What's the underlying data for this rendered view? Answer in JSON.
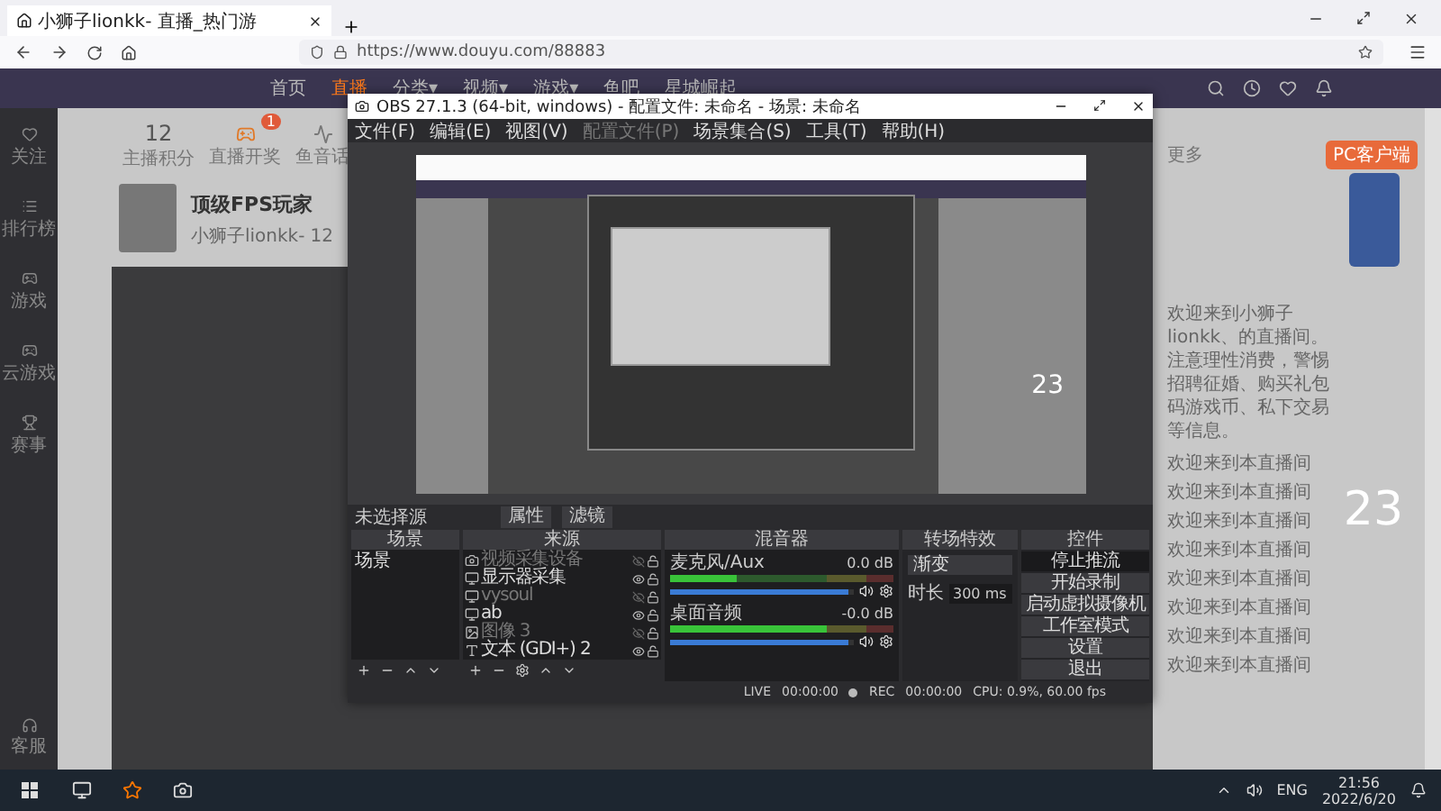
{
  "browser": {
    "tab_title": "小狮子lionkk- 直播_热门游",
    "url": "https://www.douyu.com/88883"
  },
  "site": {
    "nav": [
      {
        "label": "首页",
        "selected": false
      },
      {
        "label": "直播",
        "selected": true
      },
      {
        "label": "分类▾",
        "selected": false
      },
      {
        "label": "视频▾",
        "selected": false
      },
      {
        "label": "游戏▾",
        "selected": false
      },
      {
        "label": "鱼吧",
        "selected": false
      },
      {
        "label": "星城崛起",
        "selected": false
      }
    ],
    "sidebar": [
      "关注",
      "排行榜",
      "游戏",
      "云游戏",
      "赛事"
    ],
    "sidebar_bottom": "客服",
    "stats": {
      "score": "12",
      "score_label": "主播积分",
      "lottery_label": "直播开奖",
      "lottery_badge": "1",
      "audio_label": "鱼音话"
    },
    "streamer": {
      "title": "顶级FPS玩家",
      "name": "小狮子lionkk-",
      "hot": "12"
    },
    "right": {
      "more": "更多",
      "client_button": "PC客户端",
      "notice": "欢迎来到小狮子lionkk、的直播间。注意理性消费，警惕招聘征婚、购买礼包码游戏币、私下交易等信息。",
      "chat": [
        "欢迎来到本直播间",
        "欢迎来到本直播间",
        "欢迎来到本直播间",
        "欢迎来到本直播间",
        "欢迎来到本直播间",
        "欢迎来到本直播间",
        "欢迎来到本直播间",
        "欢迎来到本直播间"
      ],
      "big_number": "23"
    }
  },
  "obs": {
    "title": "OBS 27.1.3 (64-bit, windows) - 配置文件: 未命名 - 场景: 未命名",
    "menu": [
      {
        "label": "文件(F)",
        "disabled": false
      },
      {
        "label": "编辑(E)",
        "disabled": false
      },
      {
        "label": "视图(V)",
        "disabled": false
      },
      {
        "label": "配置文件(P)",
        "disabled": true
      },
      {
        "label": "场景集合(S)",
        "disabled": false
      },
      {
        "label": "工具(T)",
        "disabled": false
      },
      {
        "label": "帮助(H)",
        "disabled": false
      }
    ],
    "preview": {
      "number": "23"
    },
    "source_bar": {
      "label": "未选择源",
      "buttons": [
        "属性",
        "滤镜"
      ]
    },
    "scenes": {
      "title": "场景",
      "items": [
        {
          "label": "场景",
          "selected": false
        }
      ]
    },
    "sources": {
      "title": "来源",
      "items": [
        {
          "label": "视频采集设备",
          "visible": false,
          "kind": "camera"
        },
        {
          "label": "显示器采集",
          "visible": true,
          "kind": "window"
        },
        {
          "label": "vysoul",
          "visible": false,
          "kind": "window"
        },
        {
          "label": "ab",
          "visible": true,
          "kind": "window"
        },
        {
          "label": "图像 3",
          "visible": false,
          "kind": "image"
        },
        {
          "label": "文本 (GDI+) 2",
          "visible": true,
          "kind": "text"
        }
      ]
    },
    "mixer": {
      "title": "混音器",
      "tracks": [
        {
          "name": "麦克风/Aux",
          "reading": "0.0 dB",
          "meter": {
            "level": 0.3
          },
          "volume": {
            "level": 0.97
          }
        },
        {
          "name": "桌面音频",
          "reading": "-0.0 dB",
          "meter": {
            "level": 0.7
          },
          "volume": {
            "level": 0.97
          }
        }
      ]
    },
    "transitions": {
      "title": "转场特效",
      "type": "渐变",
      "duration_label": "时长",
      "duration": "300 ms"
    },
    "controls": {
      "title": "控件",
      "buttons": [
        {
          "label": "停止推流",
          "active": true
        },
        {
          "label": "开始录制",
          "active": false
        },
        {
          "label": "启动虚拟摄像机",
          "active": false
        },
        {
          "label": "工作室模式",
          "active": false
        },
        {
          "label": "设置",
          "active": false
        },
        {
          "label": "退出",
          "active": false
        }
      ]
    },
    "status": {
      "live": "LIVE",
      "live_time": "00:00:00",
      "rec": "REC",
      "rec_time": "00:00:00",
      "cpu": "CPU: 0.9%, 60.00 fps"
    }
  },
  "taskbar": {
    "lang": "ENG",
    "time": "21:56",
    "date": "2022/6/20"
  }
}
